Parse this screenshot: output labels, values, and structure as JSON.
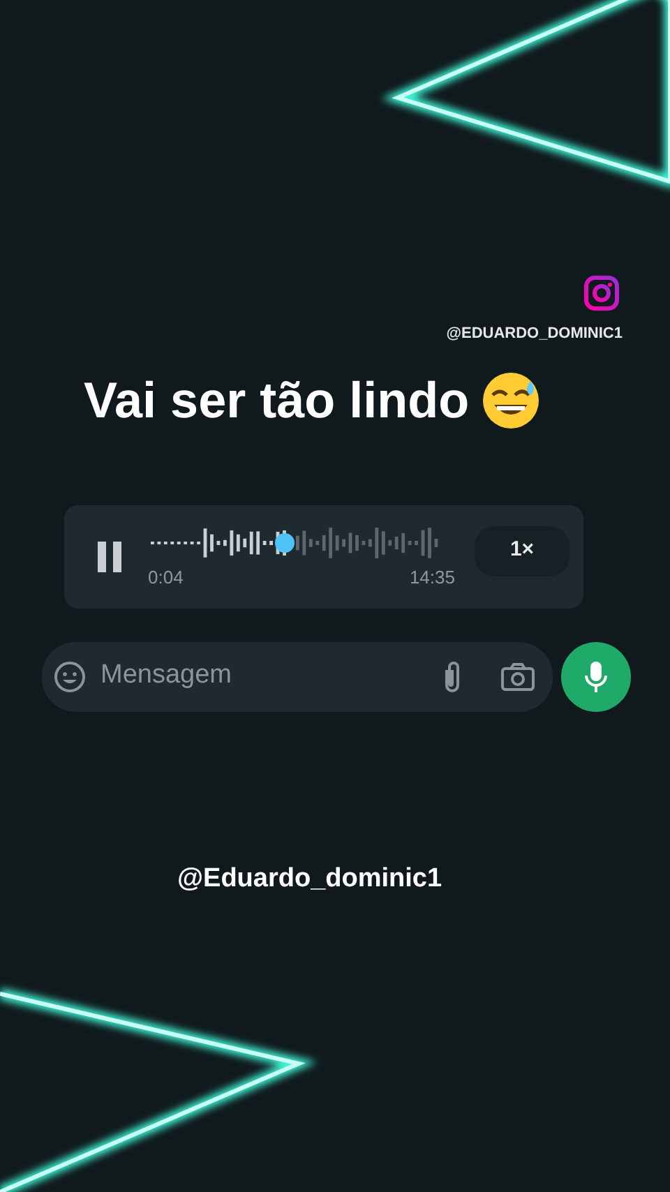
{
  "watermark_handle": "@EDUARDO_DOMINIC1",
  "caption": "Vai ser tão lindo",
  "voice_message": {
    "playing": true,
    "level": 0.46,
    "elapsed": "0:04",
    "duration": "14:35",
    "speed": "1×"
  },
  "composer": {
    "placeholder": "Mensagem"
  },
  "credit": "@Eduardo_dominic1"
}
